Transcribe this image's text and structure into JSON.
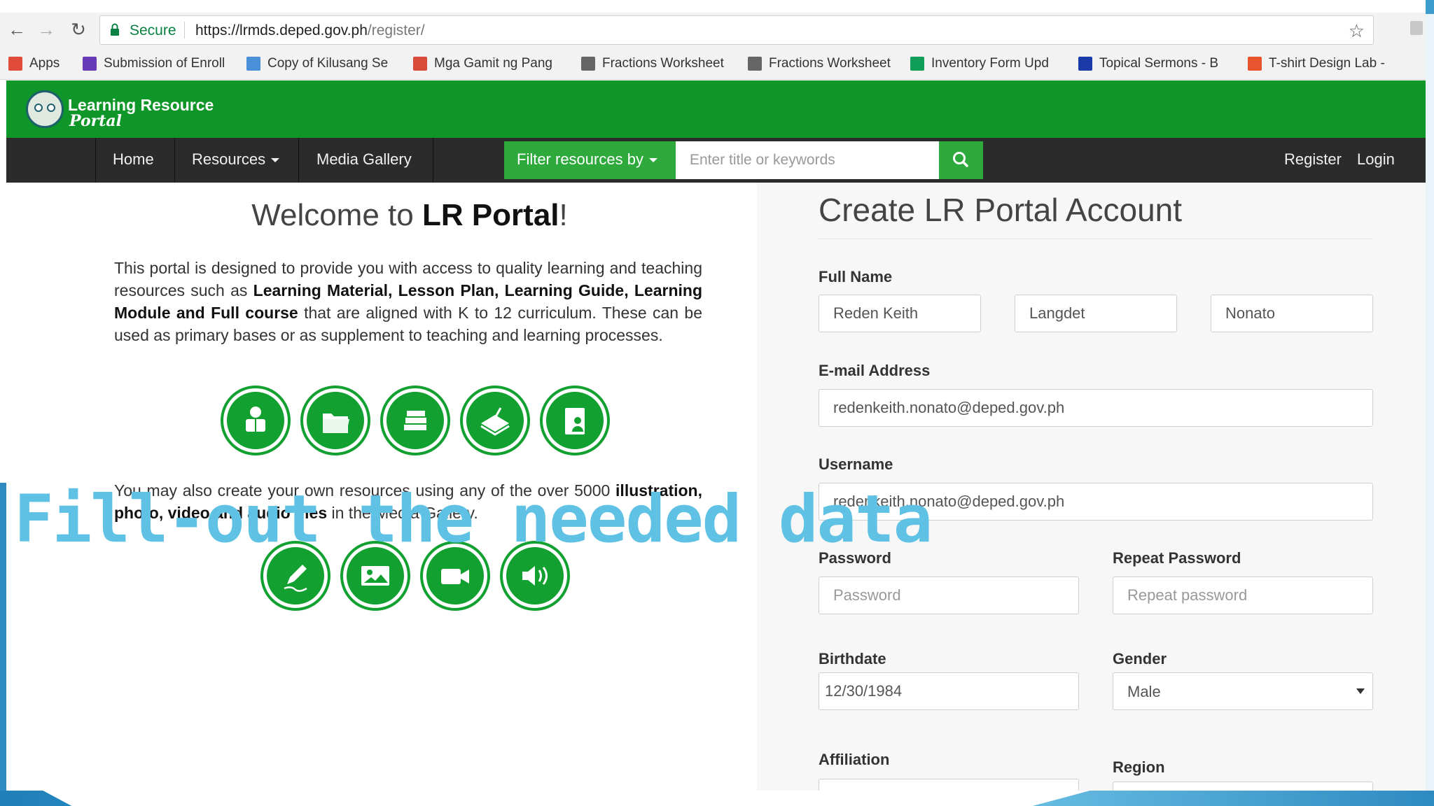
{
  "browser": {
    "secure_label": "Secure",
    "url_host": "https://lrmds.deped.gov.ph",
    "url_path": "/register/",
    "bookmarks": [
      {
        "label": "Apps",
        "icon": "apps-grid-icon",
        "color": "#e04b3a"
      },
      {
        "label": "Submission of Enroll",
        "icon": "form-icon",
        "color": "#673ab7"
      },
      {
        "label": "Copy of Kilusang Se",
        "icon": "globe-icon",
        "color": "#4a90d9"
      },
      {
        "label": "Mga Gamit ng Pang",
        "icon": "tl-icon",
        "color": "#d84a3a"
      },
      {
        "label": "Fractions Worksheet",
        "icon": "page-icon",
        "color": "#666666"
      },
      {
        "label": "Fractions Worksheet",
        "icon": "page-icon",
        "color": "#666666"
      },
      {
        "label": "Inventory Form Upd",
        "icon": "sheets-icon",
        "color": "#0f9d58"
      },
      {
        "label": "Topical Sermons - B",
        "icon": "eo-icon",
        "color": "#1a3aa8"
      },
      {
        "label": "T-shirt Design Lab -",
        "icon": "tshirt-icon",
        "color": "#e8542e"
      }
    ]
  },
  "site": {
    "logo_line1": "Learning Resource",
    "logo_line2": "Portal",
    "nav": {
      "home": "Home",
      "resources": "Resources",
      "media_gallery": "Media Gallery",
      "filter": "Filter resources by",
      "search_placeholder": "Enter title or keywords",
      "register": "Register",
      "login": "Login"
    }
  },
  "welcome": {
    "prefix": "Welcome to ",
    "brand": "LR Portal",
    "suffix": "!",
    "p1_a": "This portal is designed to provide you with access to quality learning and teaching resources such as ",
    "p1_b": "Learning Material, Lesson Plan, Learning Guide, Learning Module and Full course",
    "p1_c": " that are aligned with K to 12 curriculum. These can be used as primary bases or as supplement to teaching and learning processes.",
    "p2_a": "You may also create your own resources using any of the over 5000 ",
    "p2_b": "illustration, photo, video and audio files",
    "p2_c": " in the Media Gallery.",
    "resource_icons": [
      "reader-icon",
      "folder-icon",
      "books-icon",
      "book-pen-icon",
      "book-person-icon"
    ],
    "media_icons": [
      "pencil-icon",
      "photo-icon",
      "video-icon",
      "audio-icon"
    ]
  },
  "overlay": "Fill-out the needed data",
  "form": {
    "title": "Create LR Portal Account",
    "full_name_label": "Full Name",
    "first_name": "Reden Keith",
    "middle_name": "Langdet",
    "last_name": "Nonato",
    "email_label": "E-mail Address",
    "email": "redenkeith.nonato@deped.gov.ph",
    "username_label": "Username",
    "username": "redenkeith.nonato@deped.gov.ph",
    "password_label": "Password",
    "password_placeholder": "Password",
    "repeat_label": "Repeat Password",
    "repeat_placeholder": "Repeat password",
    "birthdate_label": "Birthdate",
    "birthdate": "12/30/1984",
    "gender_label": "Gender",
    "gender": "Male",
    "affiliation_label": "Affiliation",
    "region_label": "Region"
  },
  "colors": {
    "brand_green": "#0f9628",
    "accent_green": "#2ea93c",
    "navbar": "#2b2b2b",
    "overlay_text": "#5fc1e3"
  }
}
